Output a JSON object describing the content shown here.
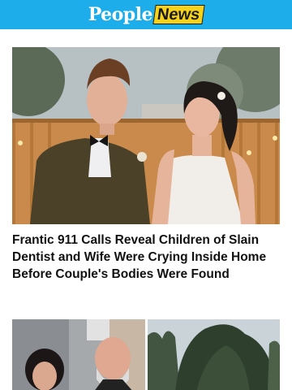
{
  "header": {
    "logo_people": "People",
    "logo_news": "News",
    "background_color": "#1cadea",
    "accent_color": "#f7d21a"
  },
  "hero": {
    "image": "couple-wedding-photo"
  },
  "article": {
    "headline": "Frantic 911 Calls Reveal Children of Slain Dentist and Wife Were Crying Inside Home Before Couple's Bodies Were Found"
  },
  "thumbnails": [
    {
      "image": "two-people-red-carpet-photo"
    },
    {
      "image": "trees-and-sky-photo"
    }
  ]
}
